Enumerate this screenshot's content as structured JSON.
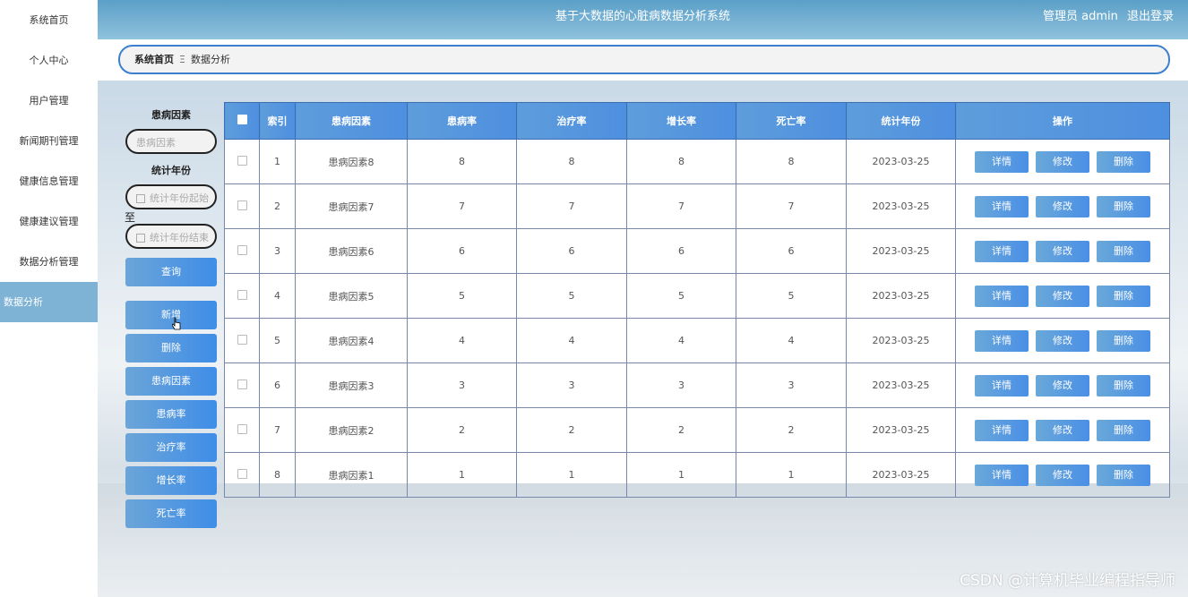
{
  "sidebar": {
    "items": [
      {
        "label": "系统首页"
      },
      {
        "label": "个人中心"
      },
      {
        "label": "用户管理"
      },
      {
        "label": "新闻期刊管理"
      },
      {
        "label": "健康信息管理"
      },
      {
        "label": "健康建议管理"
      },
      {
        "label": "数据分析管理"
      },
      {
        "label": "数据分析",
        "active": true
      }
    ]
  },
  "header": {
    "title": "基于大数据的心脏病数据分析系统",
    "user": "管理员 admin",
    "logout": "退出登录"
  },
  "breadcrumb": {
    "home": "系统首页",
    "separator": "Ξ",
    "current": "数据分析"
  },
  "search": {
    "factor_label": "患病因素",
    "factor_placeholder": "患病因素",
    "year_label": "统计年份",
    "year_start_placeholder": "统计年份起始",
    "to": "至",
    "year_end_placeholder": "统计年份结束",
    "query_button": "查询"
  },
  "actions": {
    "add": "新增",
    "delete": "删除",
    "chart_factor": "患病因素",
    "chart_rate": "患病率",
    "chart_cure": "治疗率",
    "chart_growth": "增长率",
    "chart_death": "死亡率"
  },
  "table": {
    "headers": [
      "索引",
      "患病因素",
      "患病率",
      "治疗率",
      "增长率",
      "死亡率",
      "统计年份",
      "操作"
    ],
    "rows": [
      {
        "index": "1",
        "factor": "患病因素8",
        "rate": "8",
        "cure": "8",
        "growth": "8",
        "death": "8",
        "year": "2023-03-25"
      },
      {
        "index": "2",
        "factor": "患病因素7",
        "rate": "7",
        "cure": "7",
        "growth": "7",
        "death": "7",
        "year": "2023-03-25"
      },
      {
        "index": "3",
        "factor": "患病因素6",
        "rate": "6",
        "cure": "6",
        "growth": "6",
        "death": "6",
        "year": "2023-03-25"
      },
      {
        "index": "4",
        "factor": "患病因素5",
        "rate": "5",
        "cure": "5",
        "growth": "5",
        "death": "5",
        "year": "2023-03-25"
      },
      {
        "index": "5",
        "factor": "患病因素4",
        "rate": "4",
        "cure": "4",
        "growth": "4",
        "death": "4",
        "year": "2023-03-25"
      },
      {
        "index": "6",
        "factor": "患病因素3",
        "rate": "3",
        "cure": "3",
        "growth": "3",
        "death": "3",
        "year": "2023-03-25"
      },
      {
        "index": "7",
        "factor": "患病因素2",
        "rate": "2",
        "cure": "2",
        "growth": "2",
        "death": "2",
        "year": "2023-03-25"
      },
      {
        "index": "8",
        "factor": "患病因素1",
        "rate": "1",
        "cure": "1",
        "growth": "1",
        "death": "1",
        "year": "2023-03-25"
      }
    ],
    "row_actions": {
      "detail": "详情",
      "edit": "修改",
      "delete": "删除"
    }
  },
  "watermark": "CSDN @计算机毕业编程指导师"
}
